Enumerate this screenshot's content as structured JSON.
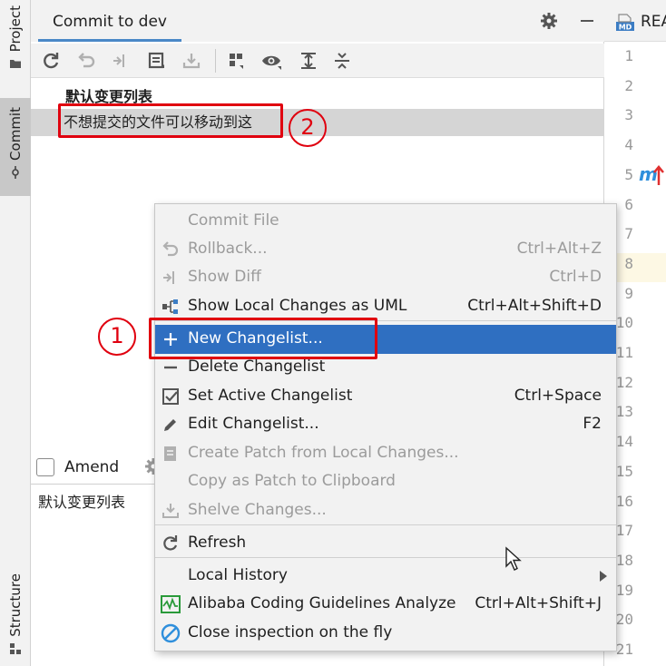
{
  "sidebar": {
    "project_label": "Project",
    "commit_label": "Commit",
    "structure_label": "Structure"
  },
  "commit_panel": {
    "tab_title": "Commit to dev",
    "tree": {
      "group_label": "默认变更列表",
      "selected_item": "不想提交的文件可以移动到这"
    },
    "amend_label": "Amend",
    "commit_message": "默认变更列表"
  },
  "editor": {
    "tab_label": "REA",
    "badge_text": "MD",
    "modified_marker": "m",
    "line_numbers": [
      "1",
      "2",
      "3",
      "4",
      "5",
      "6",
      "7",
      "8",
      "9",
      "10",
      "11",
      "12",
      "13",
      "14",
      "15",
      "16",
      "17",
      "18",
      "19",
      "20",
      "21"
    ]
  },
  "annotations": {
    "circle_1": "1",
    "circle_2": "2",
    "color": "#e0000f"
  },
  "context_menu": {
    "items": [
      {
        "label": "Commit File",
        "shortcut": "",
        "icon": "none",
        "disabled": true
      },
      {
        "label": "Rollback...",
        "shortcut": "Ctrl+Alt+Z",
        "icon": "rollback-icon",
        "disabled": true
      },
      {
        "label": "Show Diff",
        "shortcut": "Ctrl+D",
        "icon": "diff-icon",
        "disabled": true
      },
      {
        "label": "Show Local Changes as UML",
        "shortcut": "Ctrl+Alt+Shift+D",
        "icon": "uml-icon",
        "disabled": false
      },
      {
        "label": "New Changelist...",
        "shortcut": "",
        "icon": "plus-icon",
        "disabled": false,
        "highlighted": true
      },
      {
        "label": "Delete Changelist",
        "shortcut": "",
        "icon": "minus-icon",
        "disabled": false
      },
      {
        "label": "Set Active Changelist",
        "shortcut": "Ctrl+Space",
        "icon": "checkbox-icon",
        "disabled": false
      },
      {
        "label": "Edit Changelist...",
        "shortcut": "F2",
        "icon": "pencil-icon",
        "disabled": false
      },
      {
        "label": "Create Patch from Local Changes...",
        "shortcut": "",
        "icon": "patch-icon",
        "disabled": true
      },
      {
        "label": "Copy as Patch to Clipboard",
        "shortcut": "",
        "icon": "none",
        "disabled": true
      },
      {
        "label": "Shelve Changes...",
        "shortcut": "",
        "icon": "shelve-icon",
        "disabled": true
      },
      {
        "label": "Refresh",
        "shortcut": "",
        "icon": "refresh-icon",
        "disabled": false
      },
      {
        "label": "Local History",
        "shortcut": "",
        "icon": "none",
        "disabled": false,
        "submenu": true
      },
      {
        "label": "Alibaba Coding Guidelines Analyze",
        "shortcut": "Ctrl+Alt+Shift+J",
        "icon": "analyze-icon",
        "disabled": false
      },
      {
        "label": "Close inspection on the fly",
        "shortcut": "",
        "icon": "block-icon",
        "disabled": false
      }
    ]
  },
  "colors": {
    "highlight": "#2f6fc1",
    "tab_underline": "#4a88c7",
    "selected_row": "#d5d5d5"
  }
}
